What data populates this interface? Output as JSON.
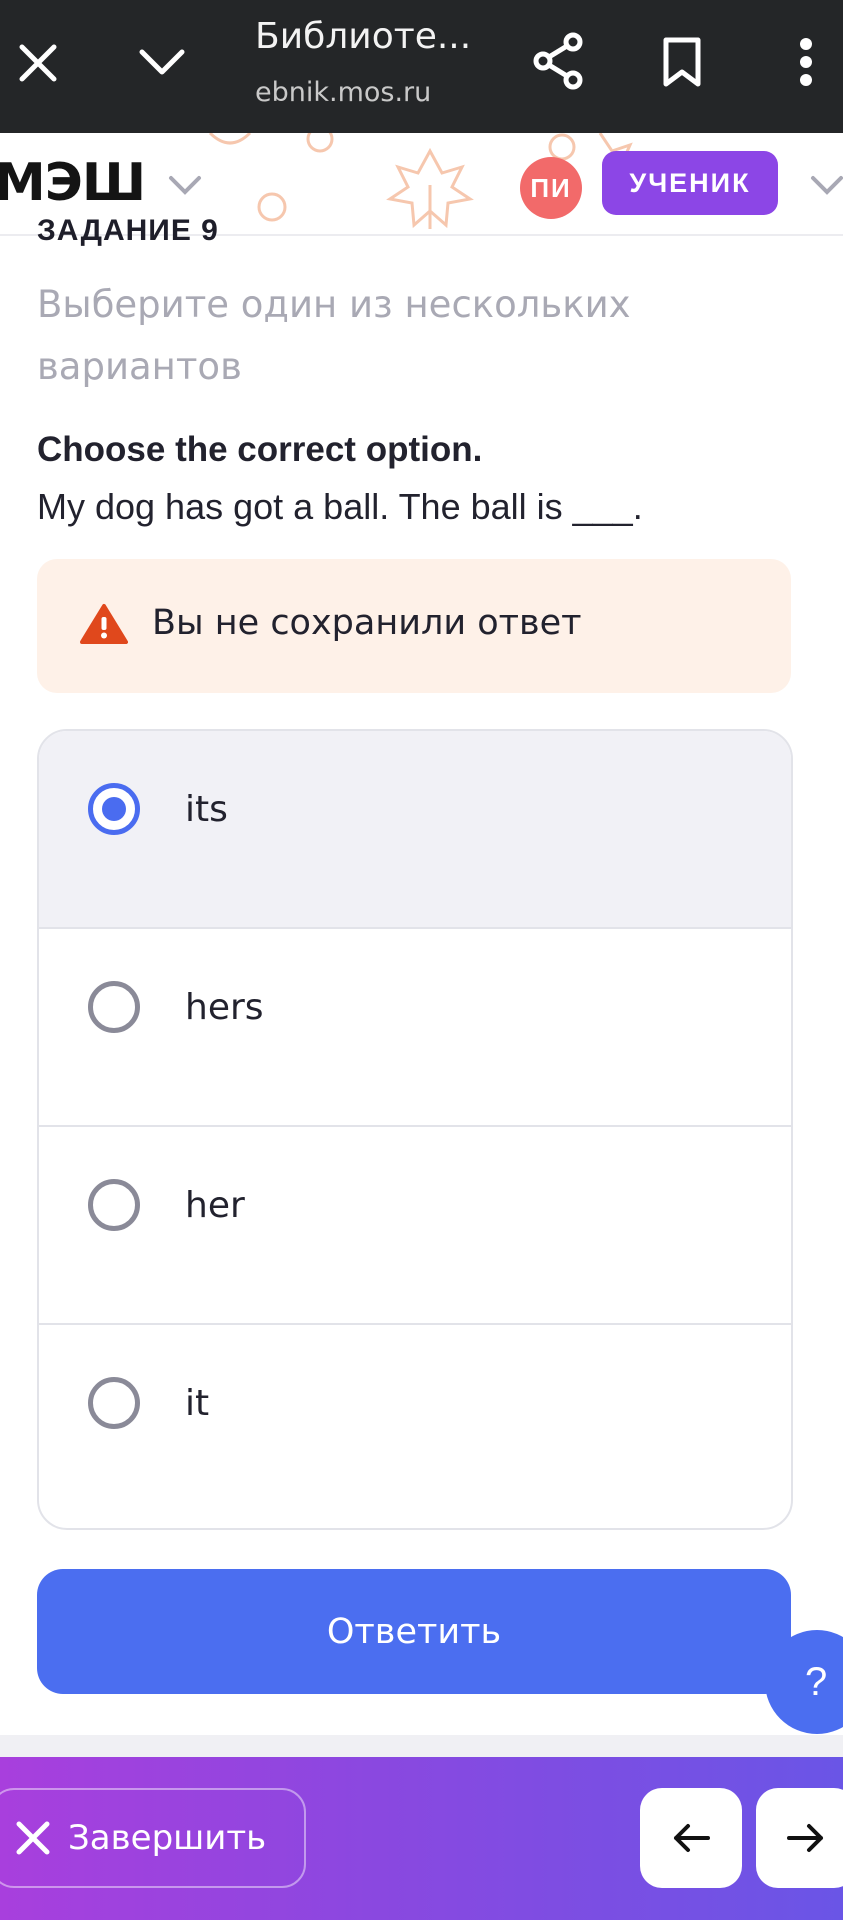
{
  "browser": {
    "title": "Библиоте...",
    "url": "ebnik.mos.ru"
  },
  "header": {
    "logo": "МЭШ",
    "avatar_initials": "ПИ",
    "role": "УЧЕНИК"
  },
  "task": {
    "label": "ЗАДАНИЕ 9",
    "instruction": "Выберите один из нескольких вариантов",
    "question_title": "Choose the correct option.",
    "question_text": "My dog has got a ball. The ball is ___.",
    "warning": "Вы не сохранили ответ",
    "options": [
      {
        "label": "its",
        "selected": true
      },
      {
        "label": "hers",
        "selected": false
      },
      {
        "label": "her",
        "selected": false
      },
      {
        "label": "it",
        "selected": false
      }
    ],
    "submit_label": "Ответить",
    "help_label": "?"
  },
  "footer": {
    "finish_label": "Завершить"
  },
  "colors": {
    "accent": "#4b6ef0",
    "brand_purple": "#8c46e6",
    "warning_bg": "#fef1e8",
    "warning_icon": "#e0481c",
    "avatar": "#f26a6a"
  }
}
